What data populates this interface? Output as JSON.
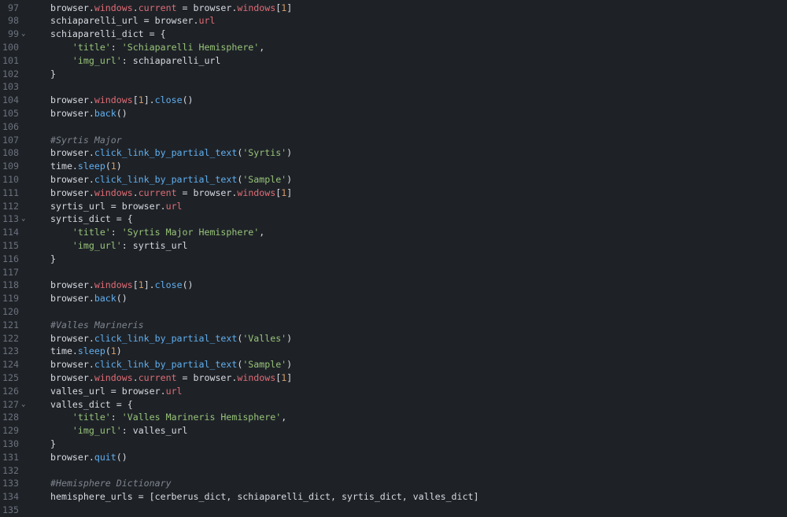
{
  "editor": {
    "lines": [
      {
        "num": "97",
        "fold": "",
        "tokens": [
          {
            "t": "browser.",
            "c": "plain"
          },
          {
            "t": "windows",
            "c": "prop"
          },
          {
            "t": ".",
            "c": "plain"
          },
          {
            "t": "current",
            "c": "prop"
          },
          {
            "t": " = browser.",
            "c": "plain"
          },
          {
            "t": "windows",
            "c": "prop"
          },
          {
            "t": "[",
            "c": "plain"
          },
          {
            "t": "1",
            "c": "num"
          },
          {
            "t": "]",
            "c": "plain"
          }
        ]
      },
      {
        "num": "98",
        "fold": "",
        "tokens": [
          {
            "t": "schiaparelli_url = browser.",
            "c": "plain"
          },
          {
            "t": "url",
            "c": "prop"
          }
        ]
      },
      {
        "num": "99",
        "fold": "⌄",
        "tokens": [
          {
            "t": "schiaparelli_dict = {",
            "c": "plain"
          }
        ]
      },
      {
        "num": "100",
        "fold": "",
        "tokens": [
          {
            "t": "    ",
            "c": "plain"
          },
          {
            "t": "'title'",
            "c": "str"
          },
          {
            "t": ": ",
            "c": "plain"
          },
          {
            "t": "'Schiaparelli Hemisphere'",
            "c": "str"
          },
          {
            "t": ",",
            "c": "plain"
          }
        ]
      },
      {
        "num": "101",
        "fold": "",
        "tokens": [
          {
            "t": "    ",
            "c": "plain"
          },
          {
            "t": "'img_url'",
            "c": "str"
          },
          {
            "t": ": schiaparelli_url",
            "c": "plain"
          }
        ]
      },
      {
        "num": "102",
        "fold": "",
        "tokens": [
          {
            "t": "}",
            "c": "plain"
          }
        ]
      },
      {
        "num": "103",
        "fold": "",
        "tokens": []
      },
      {
        "num": "104",
        "fold": "",
        "tokens": [
          {
            "t": "browser.",
            "c": "plain"
          },
          {
            "t": "windows",
            "c": "prop"
          },
          {
            "t": "[",
            "c": "plain"
          },
          {
            "t": "1",
            "c": "num"
          },
          {
            "t": "].",
            "c": "plain"
          },
          {
            "t": "close",
            "c": "method"
          },
          {
            "t": "()",
            "c": "plain"
          }
        ]
      },
      {
        "num": "105",
        "fold": "",
        "tokens": [
          {
            "t": "browser.",
            "c": "plain"
          },
          {
            "t": "back",
            "c": "method"
          },
          {
            "t": "()",
            "c": "plain"
          }
        ]
      },
      {
        "num": "106",
        "fold": "",
        "tokens": []
      },
      {
        "num": "107",
        "fold": "",
        "tokens": [
          {
            "t": "#Syrtis Major",
            "c": "comment"
          }
        ]
      },
      {
        "num": "108",
        "fold": "",
        "tokens": [
          {
            "t": "browser.",
            "c": "plain"
          },
          {
            "t": "click_link_by_partial_text",
            "c": "method"
          },
          {
            "t": "(",
            "c": "plain"
          },
          {
            "t": "'Syrtis'",
            "c": "str"
          },
          {
            "t": ")",
            "c": "plain"
          }
        ]
      },
      {
        "num": "109",
        "fold": "",
        "tokens": [
          {
            "t": "time.",
            "c": "plain"
          },
          {
            "t": "sleep",
            "c": "method"
          },
          {
            "t": "(",
            "c": "plain"
          },
          {
            "t": "1",
            "c": "num"
          },
          {
            "t": ")",
            "c": "plain"
          }
        ]
      },
      {
        "num": "110",
        "fold": "",
        "tokens": [
          {
            "t": "browser.",
            "c": "plain"
          },
          {
            "t": "click_link_by_partial_text",
            "c": "method"
          },
          {
            "t": "(",
            "c": "plain"
          },
          {
            "t": "'Sample'",
            "c": "str"
          },
          {
            "t": ")",
            "c": "plain"
          }
        ]
      },
      {
        "num": "111",
        "fold": "",
        "tokens": [
          {
            "t": "browser.",
            "c": "plain"
          },
          {
            "t": "windows",
            "c": "prop"
          },
          {
            "t": ".",
            "c": "plain"
          },
          {
            "t": "current",
            "c": "prop"
          },
          {
            "t": " = browser.",
            "c": "plain"
          },
          {
            "t": "windows",
            "c": "prop"
          },
          {
            "t": "[",
            "c": "plain"
          },
          {
            "t": "1",
            "c": "num"
          },
          {
            "t": "]",
            "c": "plain"
          }
        ]
      },
      {
        "num": "112",
        "fold": "",
        "tokens": [
          {
            "t": "syrtis_url = browser.",
            "c": "plain"
          },
          {
            "t": "url",
            "c": "prop"
          }
        ]
      },
      {
        "num": "113",
        "fold": "⌄",
        "tokens": [
          {
            "t": "syrtis_dict = {",
            "c": "plain"
          }
        ]
      },
      {
        "num": "114",
        "fold": "",
        "tokens": [
          {
            "t": "    ",
            "c": "plain"
          },
          {
            "t": "'title'",
            "c": "str"
          },
          {
            "t": ": ",
            "c": "plain"
          },
          {
            "t": "'Syrtis Major Hemisphere'",
            "c": "str"
          },
          {
            "t": ",",
            "c": "plain"
          }
        ]
      },
      {
        "num": "115",
        "fold": "",
        "tokens": [
          {
            "t": "    ",
            "c": "plain"
          },
          {
            "t": "'img_url'",
            "c": "str"
          },
          {
            "t": ": syrtis_url",
            "c": "plain"
          }
        ]
      },
      {
        "num": "116",
        "fold": "",
        "tokens": [
          {
            "t": "}",
            "c": "plain"
          }
        ]
      },
      {
        "num": "117",
        "fold": "",
        "tokens": []
      },
      {
        "num": "118",
        "fold": "",
        "tokens": [
          {
            "t": "browser.",
            "c": "plain"
          },
          {
            "t": "windows",
            "c": "prop"
          },
          {
            "t": "[",
            "c": "plain"
          },
          {
            "t": "1",
            "c": "num"
          },
          {
            "t": "].",
            "c": "plain"
          },
          {
            "t": "close",
            "c": "method"
          },
          {
            "t": "()",
            "c": "plain"
          }
        ]
      },
      {
        "num": "119",
        "fold": "",
        "tokens": [
          {
            "t": "browser.",
            "c": "plain"
          },
          {
            "t": "back",
            "c": "method"
          },
          {
            "t": "()",
            "c": "plain"
          }
        ]
      },
      {
        "num": "120",
        "fold": "",
        "tokens": []
      },
      {
        "num": "121",
        "fold": "",
        "tokens": [
          {
            "t": "#Valles Marineris",
            "c": "comment"
          }
        ]
      },
      {
        "num": "122",
        "fold": "",
        "tokens": [
          {
            "t": "browser.",
            "c": "plain"
          },
          {
            "t": "click_link_by_partial_text",
            "c": "method"
          },
          {
            "t": "(",
            "c": "plain"
          },
          {
            "t": "'Valles'",
            "c": "str"
          },
          {
            "t": ")",
            "c": "plain"
          }
        ]
      },
      {
        "num": "123",
        "fold": "",
        "tokens": [
          {
            "t": "time.",
            "c": "plain"
          },
          {
            "t": "sleep",
            "c": "method"
          },
          {
            "t": "(",
            "c": "plain"
          },
          {
            "t": "1",
            "c": "num"
          },
          {
            "t": ")",
            "c": "plain"
          }
        ]
      },
      {
        "num": "124",
        "fold": "",
        "tokens": [
          {
            "t": "browser.",
            "c": "plain"
          },
          {
            "t": "click_link_by_partial_text",
            "c": "method"
          },
          {
            "t": "(",
            "c": "plain"
          },
          {
            "t": "'Sample'",
            "c": "str"
          },
          {
            "t": ")",
            "c": "plain"
          }
        ]
      },
      {
        "num": "125",
        "fold": "",
        "tokens": [
          {
            "t": "browser.",
            "c": "plain"
          },
          {
            "t": "windows",
            "c": "prop"
          },
          {
            "t": ".",
            "c": "plain"
          },
          {
            "t": "current",
            "c": "prop"
          },
          {
            "t": " = browser.",
            "c": "plain"
          },
          {
            "t": "windows",
            "c": "prop"
          },
          {
            "t": "[",
            "c": "plain"
          },
          {
            "t": "1",
            "c": "num"
          },
          {
            "t": "]",
            "c": "plain"
          }
        ]
      },
      {
        "num": "126",
        "fold": "",
        "tokens": [
          {
            "t": "valles_url = browser.",
            "c": "plain"
          },
          {
            "t": "url",
            "c": "prop"
          }
        ]
      },
      {
        "num": "127",
        "fold": "⌄",
        "tokens": [
          {
            "t": "valles_dict = {",
            "c": "plain"
          }
        ]
      },
      {
        "num": "128",
        "fold": "",
        "tokens": [
          {
            "t": "    ",
            "c": "plain"
          },
          {
            "t": "'title'",
            "c": "str"
          },
          {
            "t": ": ",
            "c": "plain"
          },
          {
            "t": "'Valles Marineris Hemisphere'",
            "c": "str"
          },
          {
            "t": ",",
            "c": "plain"
          }
        ]
      },
      {
        "num": "129",
        "fold": "",
        "tokens": [
          {
            "t": "    ",
            "c": "plain"
          },
          {
            "t": "'img_url'",
            "c": "str"
          },
          {
            "t": ": valles_url",
            "c": "plain"
          }
        ]
      },
      {
        "num": "130",
        "fold": "",
        "tokens": [
          {
            "t": "}",
            "c": "plain"
          }
        ]
      },
      {
        "num": "131",
        "fold": "",
        "tokens": [
          {
            "t": "browser.",
            "c": "plain"
          },
          {
            "t": "quit",
            "c": "method"
          },
          {
            "t": "()",
            "c": "plain"
          }
        ]
      },
      {
        "num": "132",
        "fold": "",
        "tokens": []
      },
      {
        "num": "133",
        "fold": "",
        "tokens": [
          {
            "t": "#Hemisphere Dictionary",
            "c": "comment"
          }
        ]
      },
      {
        "num": "134",
        "fold": "",
        "tokens": [
          {
            "t": "hemisphere_urls = [cerberus_dict, schiaparelli_dict, syrtis_dict, valles_dict]",
            "c": "plain"
          }
        ]
      },
      {
        "num": "135",
        "fold": "",
        "tokens": []
      }
    ]
  },
  "colors": {
    "background": "#1e2227",
    "plain": "#d7dae0",
    "property": "#e06c75",
    "method": "#61afef",
    "number": "#d19a66",
    "string": "#98c379",
    "comment": "#7f848e",
    "gutter": "#6b717d"
  }
}
